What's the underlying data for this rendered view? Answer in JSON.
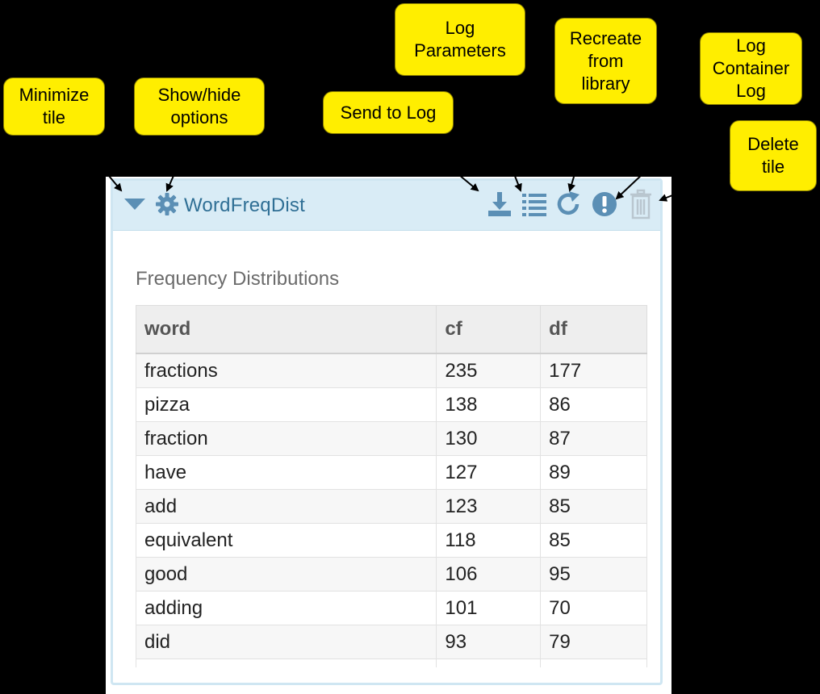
{
  "callouts": {
    "minimize": "Minimize\ntile",
    "options": "Show/hide\noptions",
    "send_to_log": "Send to Log",
    "log_parameters": "Log\nParameters",
    "recreate": "Recreate\nfrom\nlibrary",
    "log_container": "Log\nContainer\nLog",
    "delete": "Delete\ntile"
  },
  "tile": {
    "title": "WordFreqDist",
    "section_title": "Frequency Distributions",
    "icons": [
      "caret-down-icon",
      "gear-icon",
      "download-icon",
      "list-icon",
      "refresh-icon",
      "exclamation-circle-icon",
      "trash-icon"
    ]
  },
  "table": {
    "columns": [
      "word",
      "cf",
      "df"
    ],
    "rows": [
      [
        "fractions",
        "235",
        "177"
      ],
      [
        "pizza",
        "138",
        "86"
      ],
      [
        "fraction",
        "130",
        "87"
      ],
      [
        "have",
        "127",
        "89"
      ],
      [
        "add",
        "123",
        "85"
      ],
      [
        "equivalent",
        "118",
        "85"
      ],
      [
        "good",
        "106",
        "95"
      ],
      [
        "adding",
        "101",
        "70"
      ],
      [
        "did",
        "93",
        "79"
      ]
    ]
  },
  "colors": {
    "background": "#000000",
    "callout": "#ffee00",
    "header": "#d9ecf6",
    "title": "#2f6f95",
    "icon": "#5b8fb5",
    "trash_icon": "#b9c6cf"
  }
}
